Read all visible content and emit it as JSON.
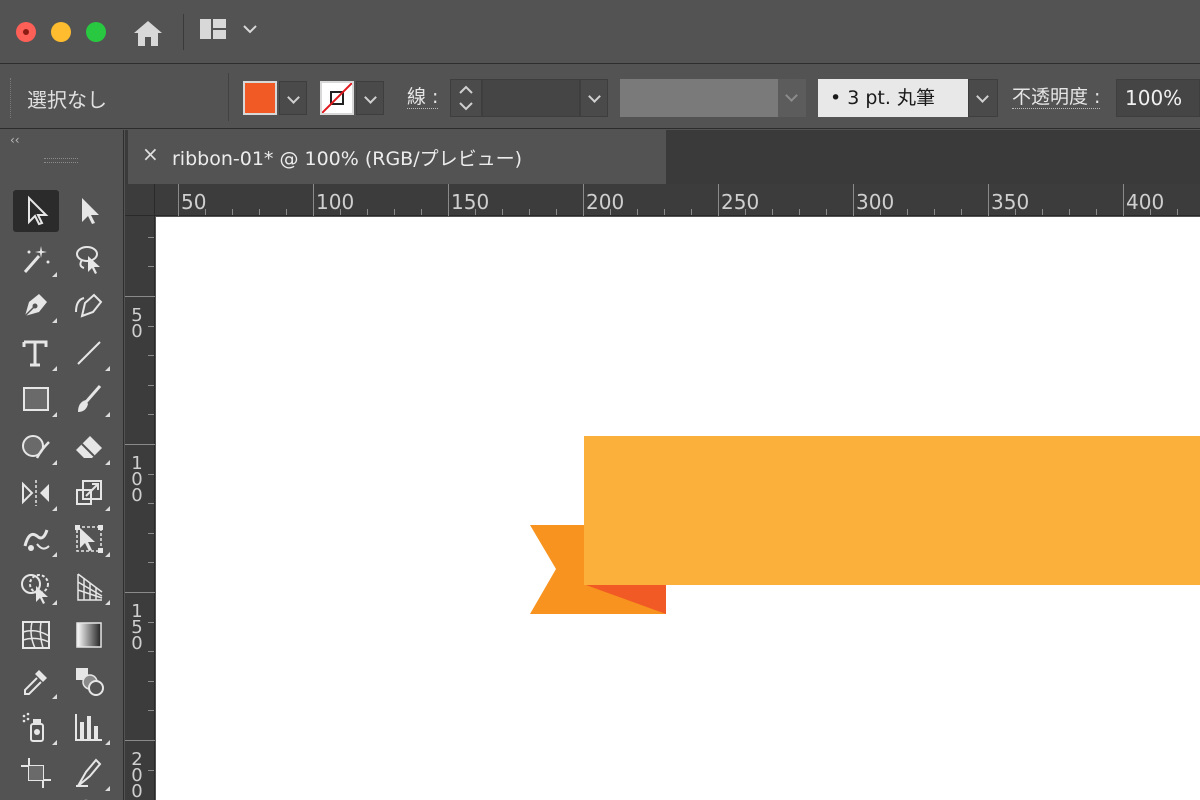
{
  "window": {
    "buttons": [
      "close",
      "minimize",
      "maximize"
    ]
  },
  "app_bar": {
    "icons": [
      "home-icon",
      "workspace-layout-icon",
      "chevron-down-icon"
    ]
  },
  "control_bar": {
    "selection_label": "選択なし",
    "fill_color": "#f15a24",
    "stroke_color": "none",
    "stroke_label": "線 :",
    "stroke_weight": "",
    "brush_definition": "•  3 pt. 丸筆",
    "opacity_label": "不透明度 :",
    "opacity_value": "100%"
  },
  "document_tab": {
    "close_glyph": "×",
    "title": "ribbon-01* @ 100% (RGB/プレビュー)"
  },
  "rulers": {
    "horizontal": [
      "50",
      "100",
      "150",
      "200",
      "250",
      "300",
      "350",
      "400"
    ],
    "vertical": [
      "50",
      "100",
      "150",
      "200"
    ]
  },
  "tools": [
    {
      "name": "selection-tool-icon",
      "active": true
    },
    {
      "name": "direct-selection-tool-icon"
    },
    {
      "name": "magic-wand-tool-icon"
    },
    {
      "name": "lasso-tool-icon"
    },
    {
      "name": "pen-tool-icon"
    },
    {
      "name": "curvature-tool-icon"
    },
    {
      "name": "type-tool-icon"
    },
    {
      "name": "line-segment-tool-icon"
    },
    {
      "name": "rectangle-tool-icon"
    },
    {
      "name": "paintbrush-tool-icon"
    },
    {
      "name": "shaper-tool-icon"
    },
    {
      "name": "eraser-tool-icon"
    },
    {
      "name": "reflect-tool-icon"
    },
    {
      "name": "scale-tool-icon"
    },
    {
      "name": "warp-tool-icon"
    },
    {
      "name": "free-transform-tool-icon"
    },
    {
      "name": "shape-builder-tool-icon"
    },
    {
      "name": "perspective-grid-tool-icon"
    },
    {
      "name": "mesh-tool-icon"
    },
    {
      "name": "gradient-tool-icon"
    },
    {
      "name": "eyedropper-tool-icon"
    },
    {
      "name": "blend-tool-icon"
    },
    {
      "name": "symbol-sprayer-tool-icon"
    },
    {
      "name": "column-graph-tool-icon"
    },
    {
      "name": "artboard-tool-icon"
    },
    {
      "name": "slice-tool-icon"
    },
    {
      "name": "hand-tool-icon"
    },
    {
      "name": "zoom-tool-icon"
    }
  ],
  "artwork": {
    "ribbon_main_color": "#fbb03b",
    "ribbon_tail_color": "#f7931e",
    "ribbon_fold_color": "#f15a24"
  }
}
